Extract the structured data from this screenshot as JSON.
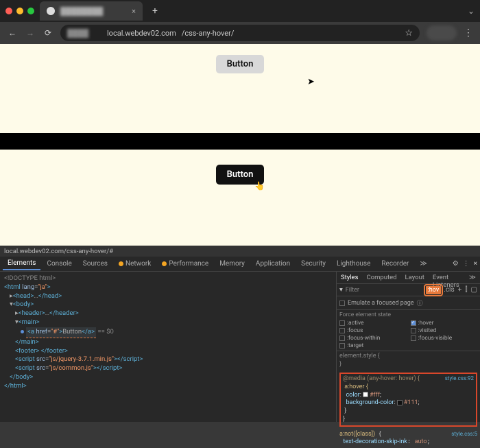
{
  "dots": [
    "#ff5f57",
    "#febc2e",
    "#28c840"
  ],
  "tab": {
    "title": "████████",
    "close": "×",
    "new": "+"
  },
  "nav": {
    "back": "←",
    "fwd": "→",
    "reload": "⟳"
  },
  "url": {
    "host": "local.webdev02.com",
    "path": "/css-any-hover/"
  },
  "star": "☆",
  "menu": "⋮",
  "page1": {
    "button": "Button"
  },
  "page2": {
    "button": "Button"
  },
  "dev": {
    "breadcrumb": "local.webdev02.com/css-any-hover/#",
    "tabs": [
      "Elements",
      "Console",
      "Sources",
      "Network",
      "Performance",
      "Memory",
      "Application",
      "Security",
      "Lighthouse",
      "Recorder"
    ],
    "active_tab": "Elements",
    "warn_tabs": [
      "Network",
      "Performance"
    ],
    "more": "≫",
    "gear": "⚙",
    "close": "×"
  },
  "elements": {
    "l0": "<!DOCTYPE html>",
    "l1o": "<html lang=\"ja\">",
    "l2": "<head>…</head>",
    "l3": "<body>",
    "l4": "<header>…</header>",
    "l5": "<main>",
    "l6": "<a href=\"#\">Button</a>",
    "l6s": " == $0",
    "l7": "</main>",
    "l8": "<footer> </footer>",
    "l9": "<script src=\"js/jquery-3.7.1.min.js\"></scr",
    "l9b": "ipt>",
    "l10": "<script src=\"js/common.js\"></scr",
    "l10b": "ipt>",
    "l11": "</body>",
    "l12": "</html>"
  },
  "styles": {
    "tabs": [
      "Styles",
      "Computed",
      "Layout",
      "Event Listeners"
    ],
    "active": "Styles",
    "more": "≫",
    "filter_icon": "▾",
    "filter": "Filter",
    "hov": ":hov",
    "cls": ".cls",
    "plus": "+",
    "pin": "⫿",
    "box": "▢",
    "emulate": "Emulate a focused page",
    "help": "ⓘ",
    "force": "Force element state",
    "states": [
      {
        "name": ":active",
        "on": false
      },
      {
        "name": ":hover",
        "on": true
      },
      {
        "name": ":focus",
        "on": false
      },
      {
        "name": ":visited",
        "on": false
      },
      {
        "name": ":focus-within",
        "on": false
      },
      {
        "name": ":focus-visible",
        "on": false
      },
      {
        "name": ":target",
        "on": false
      }
    ],
    "rule1": {
      "sel": "element.style",
      "open": "{",
      "close": "}"
    },
    "rule2": {
      "media": "@media (any-hover: hover) {",
      "sel": "a:hover {",
      "p1": "color",
      "v1": "#fff",
      "sw1": "#ffffff",
      "p2": "background-color",
      "v2": "#111",
      "sw2": "#111111",
      "close1": "}",
      "close2": "}",
      "link": "style.css:92"
    },
    "rule3": {
      "sel": "a:not([class])",
      "open": "{",
      "prop": "text-decoration-skip-ink",
      "val": "auto",
      "link": "style.css:5"
    }
  }
}
